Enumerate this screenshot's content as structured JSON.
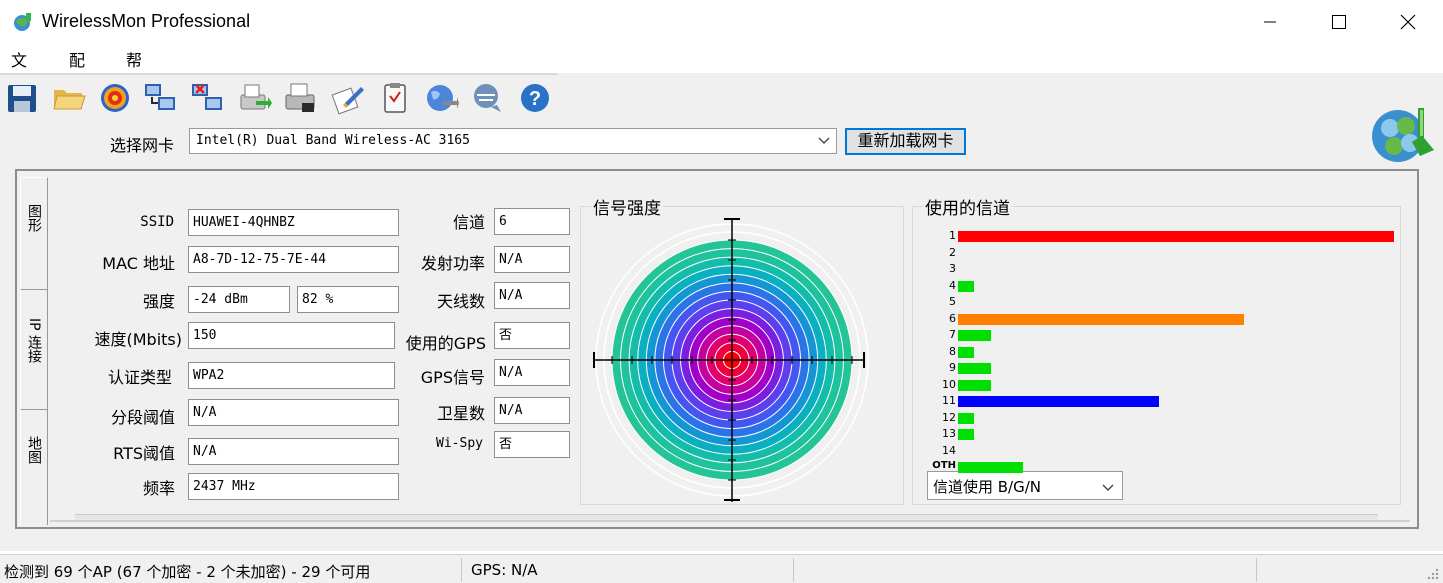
{
  "window": {
    "title": "WirelessMon Professional"
  },
  "menu": [
    "文件",
    "配置",
    "帮助"
  ],
  "toolbar": {
    "icons": [
      "save-icon",
      "open-folder-icon",
      "target-icon",
      "network-connect-icon",
      "network-disconnect-icon",
      "export-icon",
      "print-icon",
      "settings-icon",
      "clipboard-icon",
      "globe-icon",
      "chat-icon",
      "help-icon"
    ]
  },
  "adapter": {
    "label": "选择网卡",
    "selected": "Intel(R) Dual Band Wireless-AC 3165",
    "reload_label": "重新加载网卡"
  },
  "tabs": [
    "图形",
    "IP 连接",
    "地图"
  ],
  "info": {
    "ssid_label": "SSID",
    "ssid": "HUAWEI-4QHNBZ",
    "mac_label": "MAC 地址",
    "mac": "A8-7D-12-75-7E-44",
    "strength_label": "强度",
    "strength_dbm": "-24 dBm",
    "strength_pct": "82 %",
    "speed_label": "速度(Mbits)",
    "speed": "150",
    "auth_label": "认证类型",
    "auth": "WPA2",
    "frag_label": "分段阈值",
    "frag": "N/A",
    "rts_label": "RTS阈值",
    "rts": "N/A",
    "freq_label": "频率",
    "freq": "2437 MHz",
    "channel_label": "信道",
    "channel": "6",
    "txpower_label": "发射功率",
    "txpower": "N/A",
    "antenna_label": "天线数",
    "antenna": "N/A",
    "gps_used_label": "使用的GPS",
    "gps_used": "否",
    "gps_signal_label": "GPS信号",
    "gps_signal": "N/A",
    "satellites_label": "卫星数",
    "satellites": "N/A",
    "wispy_label": "Wi-Spy",
    "wispy": "否"
  },
  "signal": {
    "title": "信号强度",
    "colors": [
      "#ff0000",
      "#f0003a",
      "#e10070",
      "#c400a0",
      "#a000c8",
      "#7a1ee0",
      "#5c40ee",
      "#4456f0",
      "#2a74e8",
      "#1496d4",
      "#0ab0c0",
      "#14bcaa",
      "#1ec29c",
      "#24c496"
    ]
  },
  "channels": {
    "title": "使用的信道",
    "select_value": "信道使用 B/G/N",
    "labels": [
      "1",
      "2",
      "3",
      "4",
      "5",
      "6",
      "7",
      "8",
      "9",
      "10",
      "11",
      "12",
      "13",
      "14",
      "OTH"
    ],
    "usage": [
      1.0,
      0,
      0,
      0.037,
      0,
      0.655,
      0.076,
      0.037,
      0.076,
      0.076,
      0.46,
      0.037,
      0.037,
      0,
      0.15
    ],
    "bar_colors": [
      "#ff0000",
      "#00e000",
      "#00e000",
      "#00e000",
      "#00e000",
      "#ff7f00",
      "#00e000",
      "#00e000",
      "#00e000",
      "#00e000",
      "#0000ff",
      "#00e000",
      "#00e000",
      "#00e000",
      "#00e000"
    ]
  },
  "status": {
    "ap_text": "检测到 69 个AP (67 个加密 - 2 个未加密) - 29 个可用",
    "gps_text": "GPS: N/A"
  }
}
